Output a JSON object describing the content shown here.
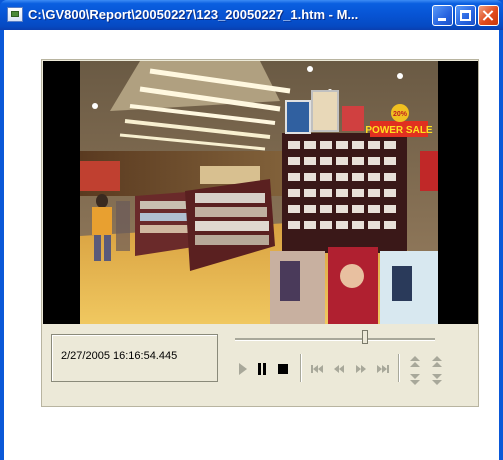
{
  "window": {
    "title": "C:\\GV800\\Report\\20050227\\123_20050227_1.htm - M...",
    "buttons": [
      "minimize-button",
      "maximize-button",
      "close-button"
    ]
  },
  "player": {
    "timestamp": "2/27/2005 16:16:54.445",
    "seek_position": 0.65,
    "video_overlay": {
      "sign": "POWER SALE",
      "badge": "20%"
    },
    "controls": [
      {
        "name": "play-button",
        "icon": "play-icon",
        "enabled": false
      },
      {
        "name": "pause-button",
        "icon": "pause-icon",
        "enabled": true
      },
      {
        "name": "stop-button",
        "icon": "stop-icon",
        "enabled": true
      },
      {
        "name": "first-frame-button",
        "icon": "skip-start-icon",
        "enabled": false
      },
      {
        "name": "step-back-button",
        "icon": "rewind-icon",
        "enabled": false
      },
      {
        "name": "step-forward-button",
        "icon": "fast-forward-icon",
        "enabled": false
      },
      {
        "name": "last-frame-button",
        "icon": "skip-end-icon",
        "enabled": false
      },
      {
        "name": "speed-up-button",
        "icon": "double-up-icon",
        "enabled": false
      },
      {
        "name": "speed-down-button",
        "icon": "double-down-icon",
        "enabled": false
      }
    ]
  },
  "colors": {
    "titlebar": "#0754d4",
    "disabled_icon": "#a8a89a",
    "enabled_icon": "#000000",
    "panel": "#ece9d8"
  }
}
